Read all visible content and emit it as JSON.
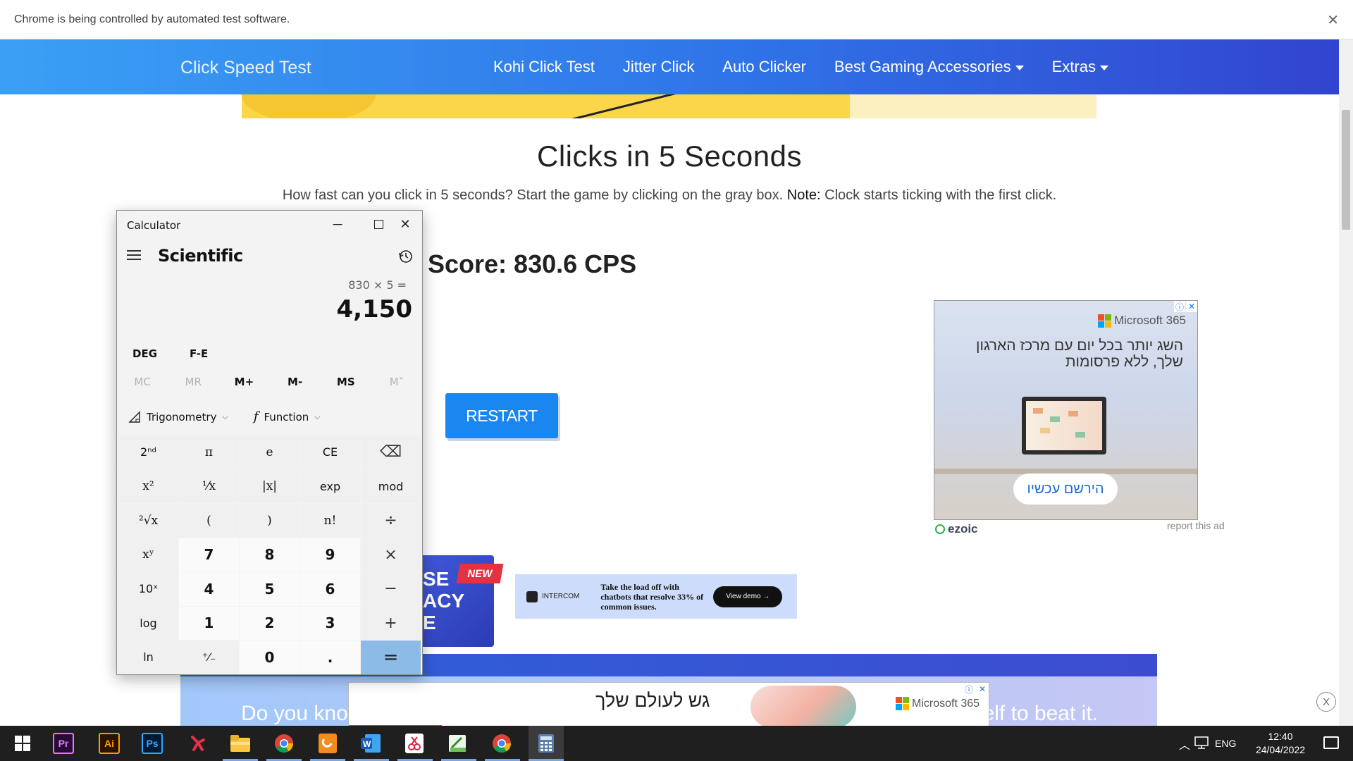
{
  "browser": {
    "infobar_text": "Chrome is being controlled by automated test software.",
    "infobar_close": "✕"
  },
  "nav": {
    "brand": "Click Speed Test",
    "links": [
      "Kohi Click Test",
      "Jitter Click",
      "Auto Clicker",
      "Best Gaming Accessories",
      "Extras"
    ]
  },
  "main": {
    "heading": "Clicks in 5 Seconds",
    "subtitle_pre": "How fast can you click in 5 seconds? Start the game by clicking on the gray box.",
    "subtitle_note_label": "Note:",
    "subtitle_post": "Clock starts ticking with the first click.",
    "score": "Score: 830.6 CPS",
    "restart_label": "RESTART"
  },
  "ad_right": {
    "brand": "Microsoft 365",
    "text": "השג יותר בכל יום עם מרכז הארגון שלך, ללא פרסומות",
    "cta": "הירשם עכשיו",
    "info_icon": "ⓘ",
    "close_icon": "✕",
    "ezoic": "ezoic",
    "report": "report this ad"
  },
  "promo": {
    "text_lines": [
      "SE",
      "ACY",
      "E"
    ],
    "badge": "NEW"
  },
  "intercom_ad": {
    "logo": "INTERCOM",
    "message": "Take the load off with chatbots that resolve 33% of common issues.",
    "button": "View demo →"
  },
  "bottom": {
    "text_left": "Do you know",
    "text_right": "elf to beat it."
  },
  "bottom_ad": {
    "text": "גש לעולם שלך",
    "brand": "Microsoft 365",
    "close_label": "X"
  },
  "calculator": {
    "window_title": "Calculator",
    "mode": "Scientific",
    "expression": "830 × 5 =",
    "result": "4,150",
    "angle_unit": "DEG",
    "fe_label": "F-E",
    "memory": [
      "MC",
      "MR",
      "M+",
      "M-",
      "MS",
      "M˅"
    ],
    "trig_label": "Trigonometry",
    "function_label": "Function",
    "keys": [
      [
        "2ⁿᵈ",
        "π",
        "e",
        "CE",
        "⌫"
      ],
      [
        "x²",
        "¹⁄x",
        "|x|",
        "exp",
        "mod"
      ],
      [
        "²√x",
        "(",
        ")",
        "n!",
        "÷"
      ],
      [
        "xʸ",
        "7",
        "8",
        "9",
        "×"
      ],
      [
        "10ˣ",
        "4",
        "5",
        "6",
        "−"
      ],
      [
        "log",
        "1",
        "2",
        "3",
        "+"
      ],
      [
        "ln",
        "⁺⁄₋",
        "0",
        ".",
        "="
      ]
    ]
  },
  "taskbar": {
    "apps": [
      "Pr",
      "Ai",
      "Ps"
    ],
    "language": "ENG",
    "time": "12:40",
    "date": "24/04/2022"
  },
  "colors": {
    "nav_start": "#3aa0f5",
    "nav_end": "#3244cf",
    "restart": "#1a86f0",
    "equals_key": "#8dbbe8"
  }
}
